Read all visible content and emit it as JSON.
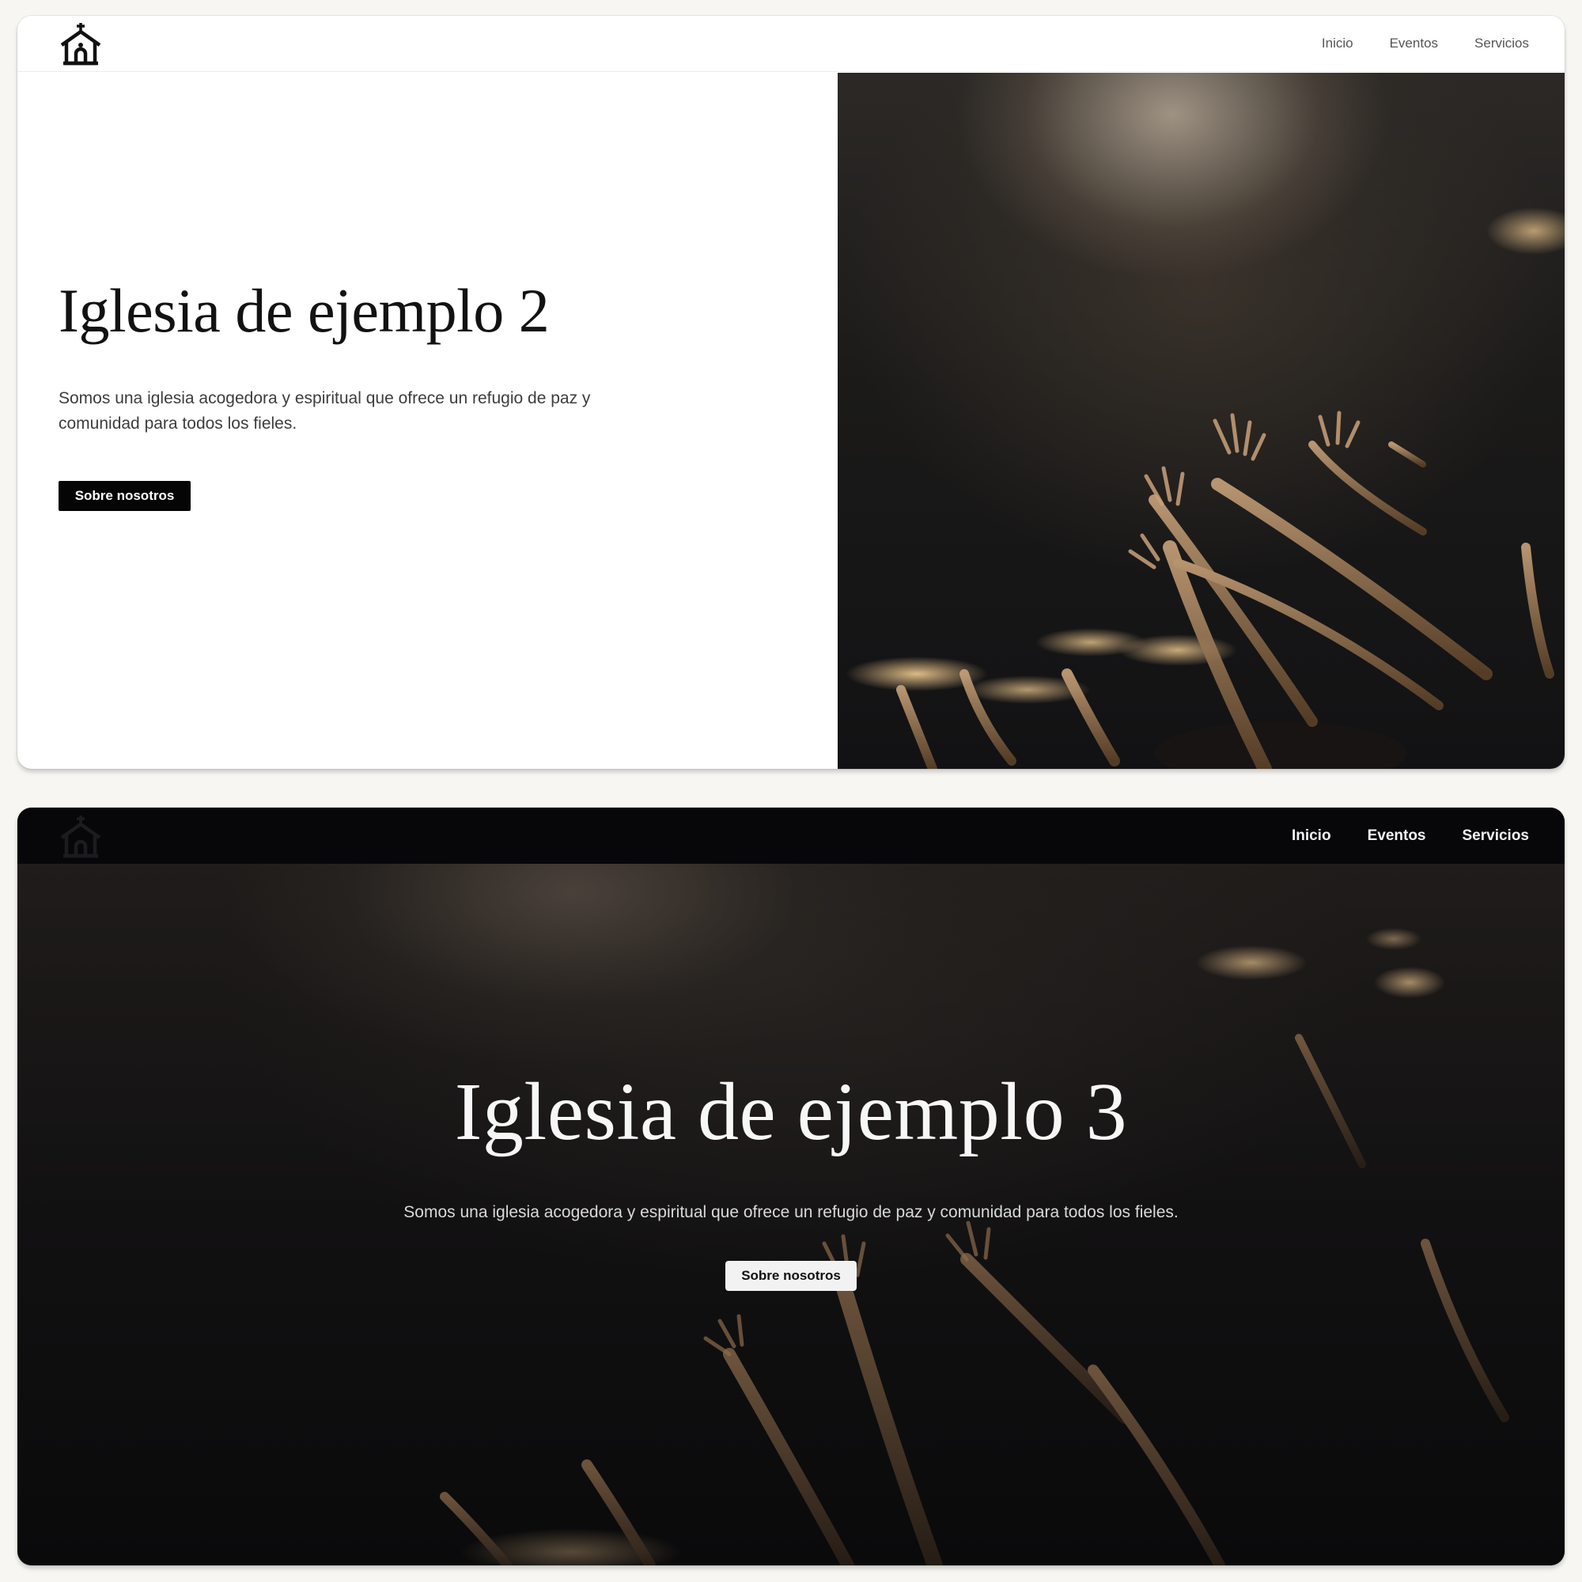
{
  "cards": [
    {
      "variant": "light",
      "nav": {
        "logo_icon": "church-icon",
        "links": [
          "Inicio",
          "Eventos",
          "Servicios"
        ]
      },
      "hero": {
        "title": "Iglesia de ejemplo 2",
        "text": "Somos una iglesia acogedora y espiritual que ofrece un refugio de paz y comunidad para todos los fieles.",
        "button_label": "Sobre nosotros",
        "image": "worship-crowd-raised-hands-photo"
      }
    },
    {
      "variant": "dark",
      "nav": {
        "logo_icon": "church-icon",
        "links": [
          "Inicio",
          "Eventos",
          "Servicios"
        ]
      },
      "hero": {
        "title": "Iglesia de ejemplo 3",
        "text": "Somos una iglesia acogedora y espiritual que ofrece un refugio de paz y comunidad para todos los fieles.",
        "button_label": "Sobre nosotros",
        "image": "worship-crowd-raised-hands-photo"
      }
    }
  ],
  "colors": {
    "page_bg": "#f7f6f3",
    "light_button_bg": "#050505",
    "dark_bg": "#0c0c0e",
    "dark_button_bg": "#f2f2f2"
  }
}
